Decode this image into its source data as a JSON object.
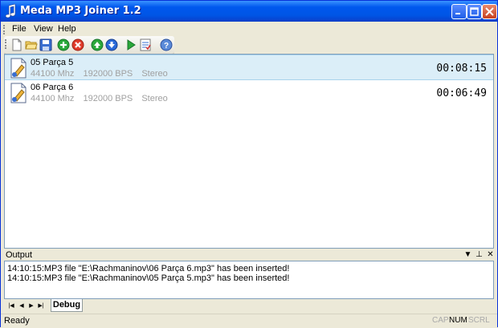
{
  "window": {
    "title": "Meda MP3 Joiner 1.2",
    "colors": {
      "titlebar": "#0058ee",
      "selection": "#dbeef8",
      "muted_text": "#a0a0a0"
    }
  },
  "menu": [
    "File",
    "View",
    "Help"
  ],
  "toolbar": {
    "icons": [
      "new-icon",
      "open-folder-icon",
      "save-icon",
      "add-icon",
      "remove-icon",
      "move-up-icon",
      "move-down-icon",
      "play-icon",
      "checklist-icon",
      "help-icon"
    ]
  },
  "files": [
    {
      "name": "05 Parça 5",
      "frequency": "44100 Mhz",
      "bitrate": "192000 BPS",
      "channels": "Stereo",
      "duration": "00:08:15",
      "selected": true
    },
    {
      "name": "06 Parça 6",
      "frequency": "44100 Mhz",
      "bitrate": "192000 BPS",
      "channels": "Stereo",
      "duration": "00:06:49",
      "selected": false
    }
  ],
  "output": {
    "title": "Output",
    "lines": [
      "14:10:15:MP3 file \"E:\\Rachmaninov\\06 Parça 6.mp3\" has been inserted!",
      "14:10:15:MP3 file \"E:\\Rachmaninov\\05 Parça 5.mp3\" has been inserted!"
    ],
    "tab": "Debug"
  },
  "status": {
    "text": "Ready",
    "indicators": [
      {
        "label": "CAP",
        "active": false
      },
      {
        "label": "NUM",
        "active": true
      },
      {
        "label": "SCRL",
        "active": false
      }
    ]
  }
}
